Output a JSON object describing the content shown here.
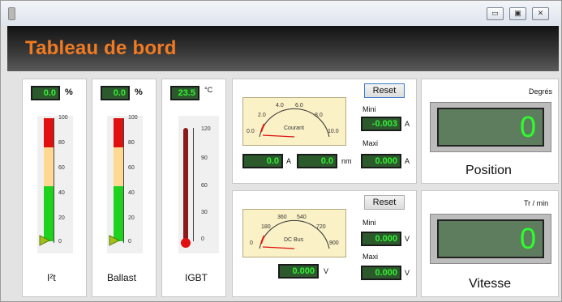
{
  "window": {
    "title": "",
    "controls": {
      "minimize": "▭",
      "maximize": "▣",
      "close": "✕"
    }
  },
  "header": {
    "title": "Tableau de bord"
  },
  "gauges": [
    {
      "name": "I²t",
      "value": "0.0",
      "unit": "%",
      "ticks": [
        "100",
        "80",
        "60",
        "40",
        "20",
        "0"
      ]
    },
    {
      "name": "Ballast",
      "value": "0.0",
      "unit": "%",
      "ticks": [
        "100",
        "80",
        "60",
        "40",
        "20",
        "0"
      ]
    },
    {
      "name": "IGBT",
      "value": "23.5",
      "unit": "°C",
      "ticks": [
        "120",
        "90",
        "60",
        "30",
        "0"
      ]
    }
  ],
  "current": {
    "reset_label": "Reset",
    "meter_label": "Courant",
    "meter_scale": [
      "0.0",
      "2.0",
      "4.0",
      "6.0",
      "8.0",
      "10.0"
    ],
    "value": "0.0",
    "value_unit": "A",
    "torque": "0.0",
    "torque_unit": "nm",
    "mini_label": "Mini",
    "mini_value": "-0.003",
    "mini_unit": "A",
    "maxi_label": "Maxi",
    "maxi_value": "0.000",
    "maxi_unit": "A"
  },
  "voltage": {
    "reset_label": "Reset",
    "meter_label": "DC Bus",
    "meter_scale": [
      "0",
      "180",
      "360",
      "540",
      "720",
      "900"
    ],
    "value": "0.000",
    "value_unit": "V",
    "mini_label": "Mini",
    "mini_value": "0.000",
    "mini_unit": "V",
    "maxi_label": "Maxi",
    "maxi_value": "0.000",
    "maxi_unit": "V"
  },
  "position": {
    "unit": "Degrés",
    "value": "0",
    "label": "Position"
  },
  "speed": {
    "unit": "Tr / min",
    "value": "0",
    "label": "Vitesse"
  },
  "colors": {
    "accent": "#f27b22",
    "lcd_bg": "#2c5a2c",
    "lcd_text": "#34f034"
  }
}
